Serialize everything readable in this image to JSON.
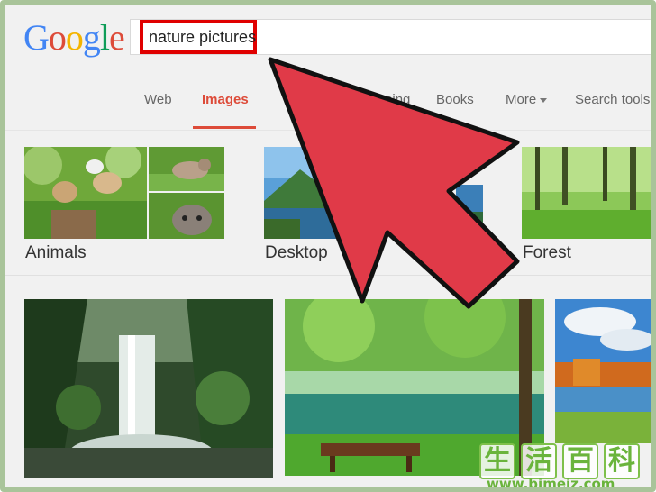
{
  "search": {
    "query": "nature pictures"
  },
  "logo": {
    "letters": [
      "G",
      "o",
      "o",
      "g",
      "l",
      "e"
    ],
    "colors": [
      "#4285f4",
      "#dd4b39",
      "#f4b400",
      "#4285f4",
      "#0f9d58",
      "#dd4b39"
    ]
  },
  "tabs": [
    {
      "label": "Web",
      "active": false
    },
    {
      "label": "Images",
      "active": true
    },
    {
      "label": "Shopping",
      "active": false
    },
    {
      "label": "Books",
      "active": false
    },
    {
      "label": "More",
      "active": false
    },
    {
      "label": "Search tools",
      "active": false
    }
  ],
  "categories": [
    {
      "label": "Animals"
    },
    {
      "label": "Desktop"
    },
    {
      "label": "Forest"
    }
  ],
  "colors": {
    "accent": "#dd4b39",
    "highlight_box": "#e00000",
    "arrow": "#e03a48",
    "frame": "#a9c49a",
    "watermark": "#6ab43c"
  },
  "watermark": {
    "chars": [
      "生",
      "活",
      "百",
      "科"
    ],
    "url": "www.bimeiz.com"
  }
}
